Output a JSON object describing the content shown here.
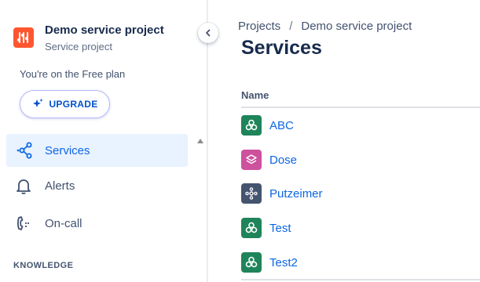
{
  "sidebar": {
    "project_name": "Demo service project",
    "project_type": "Service project",
    "plan_text": "You're on the Free plan",
    "upgrade_label": "UPGRADE",
    "nav": [
      {
        "label": "Services",
        "icon": "services-icon",
        "active": true
      },
      {
        "label": "Alerts",
        "icon": "bell-icon",
        "active": false
      },
      {
        "label": "On-call",
        "icon": "on-call-icon",
        "active": false
      }
    ],
    "section_heading": "KNOWLEDGE"
  },
  "breadcrumb": {
    "items": [
      "Projects",
      "Demo service project"
    ],
    "separator": "/"
  },
  "page_title": "Services",
  "table": {
    "column_header": "Name",
    "rows": [
      {
        "name": "ABC",
        "icon": "cluster-icon",
        "color": "#1f845a"
      },
      {
        "name": "Dose",
        "icon": "layers-icon",
        "color": "#cd519d"
      },
      {
        "name": "Putzeimer",
        "icon": "nodes-icon",
        "color": "#44546f"
      },
      {
        "name": "Test",
        "icon": "cluster-icon",
        "color": "#1f845a"
      },
      {
        "name": "Test2",
        "icon": "cluster-icon",
        "color": "#1f845a"
      }
    ]
  },
  "colors": {
    "accent": "#0c66e4",
    "active_bg": "#e9f2ff",
    "project_avatar": "#ff5630"
  }
}
